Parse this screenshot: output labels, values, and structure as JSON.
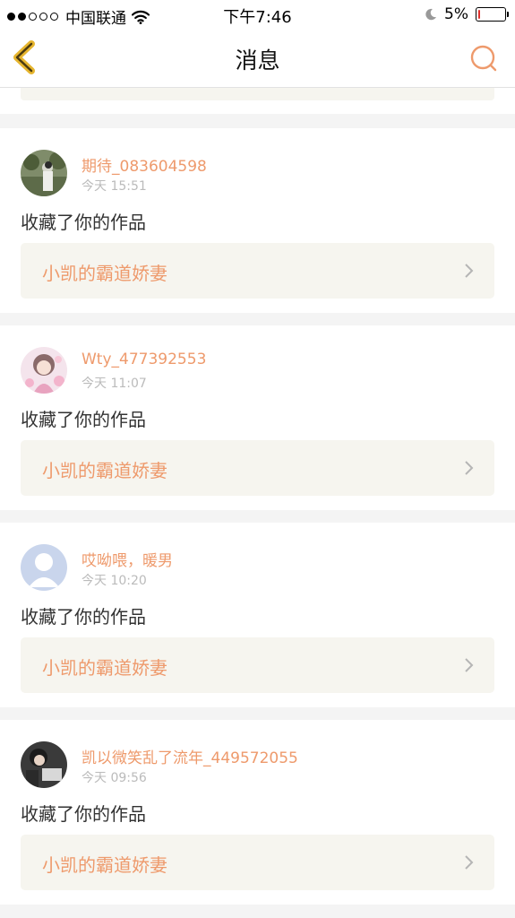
{
  "status_bar": {
    "carrier": "中国联通",
    "time": "下午7:46",
    "battery_text": "5%",
    "battery_level": 0.05,
    "signal_bars_filled": 2,
    "signal_bars_total": 5,
    "battery_color": "#e0302c"
  },
  "nav": {
    "title": "消息",
    "back_icon": "chevron-left-icon",
    "search_icon": "search-icon",
    "accent_color": "#ee9a6c"
  },
  "messages": [
    {
      "user": "期待_083604598",
      "time": "今天 15:51",
      "action": "收藏了你的作品",
      "work_title": "小凯的霸道娇妻",
      "avatar": "photo-avatar"
    },
    {
      "user": "Wty_477392553",
      "time": "今天 11:07",
      "action": "收藏了你的作品",
      "work_title": "小凯的霸道娇妻",
      "avatar": "illustration-avatar"
    },
    {
      "user": "哎呦喂，暖男",
      "time": "今天 10:20",
      "action": "收藏了你的作品",
      "work_title": "小凯的霸道娇妻",
      "avatar": "default-avatar"
    },
    {
      "user": "凯以微笑乱了流年_449572055",
      "time": "今天 09:56",
      "action": "收藏了你的作品",
      "work_title": "小凯的霸道娇妻",
      "avatar": "photo-avatar"
    }
  ]
}
